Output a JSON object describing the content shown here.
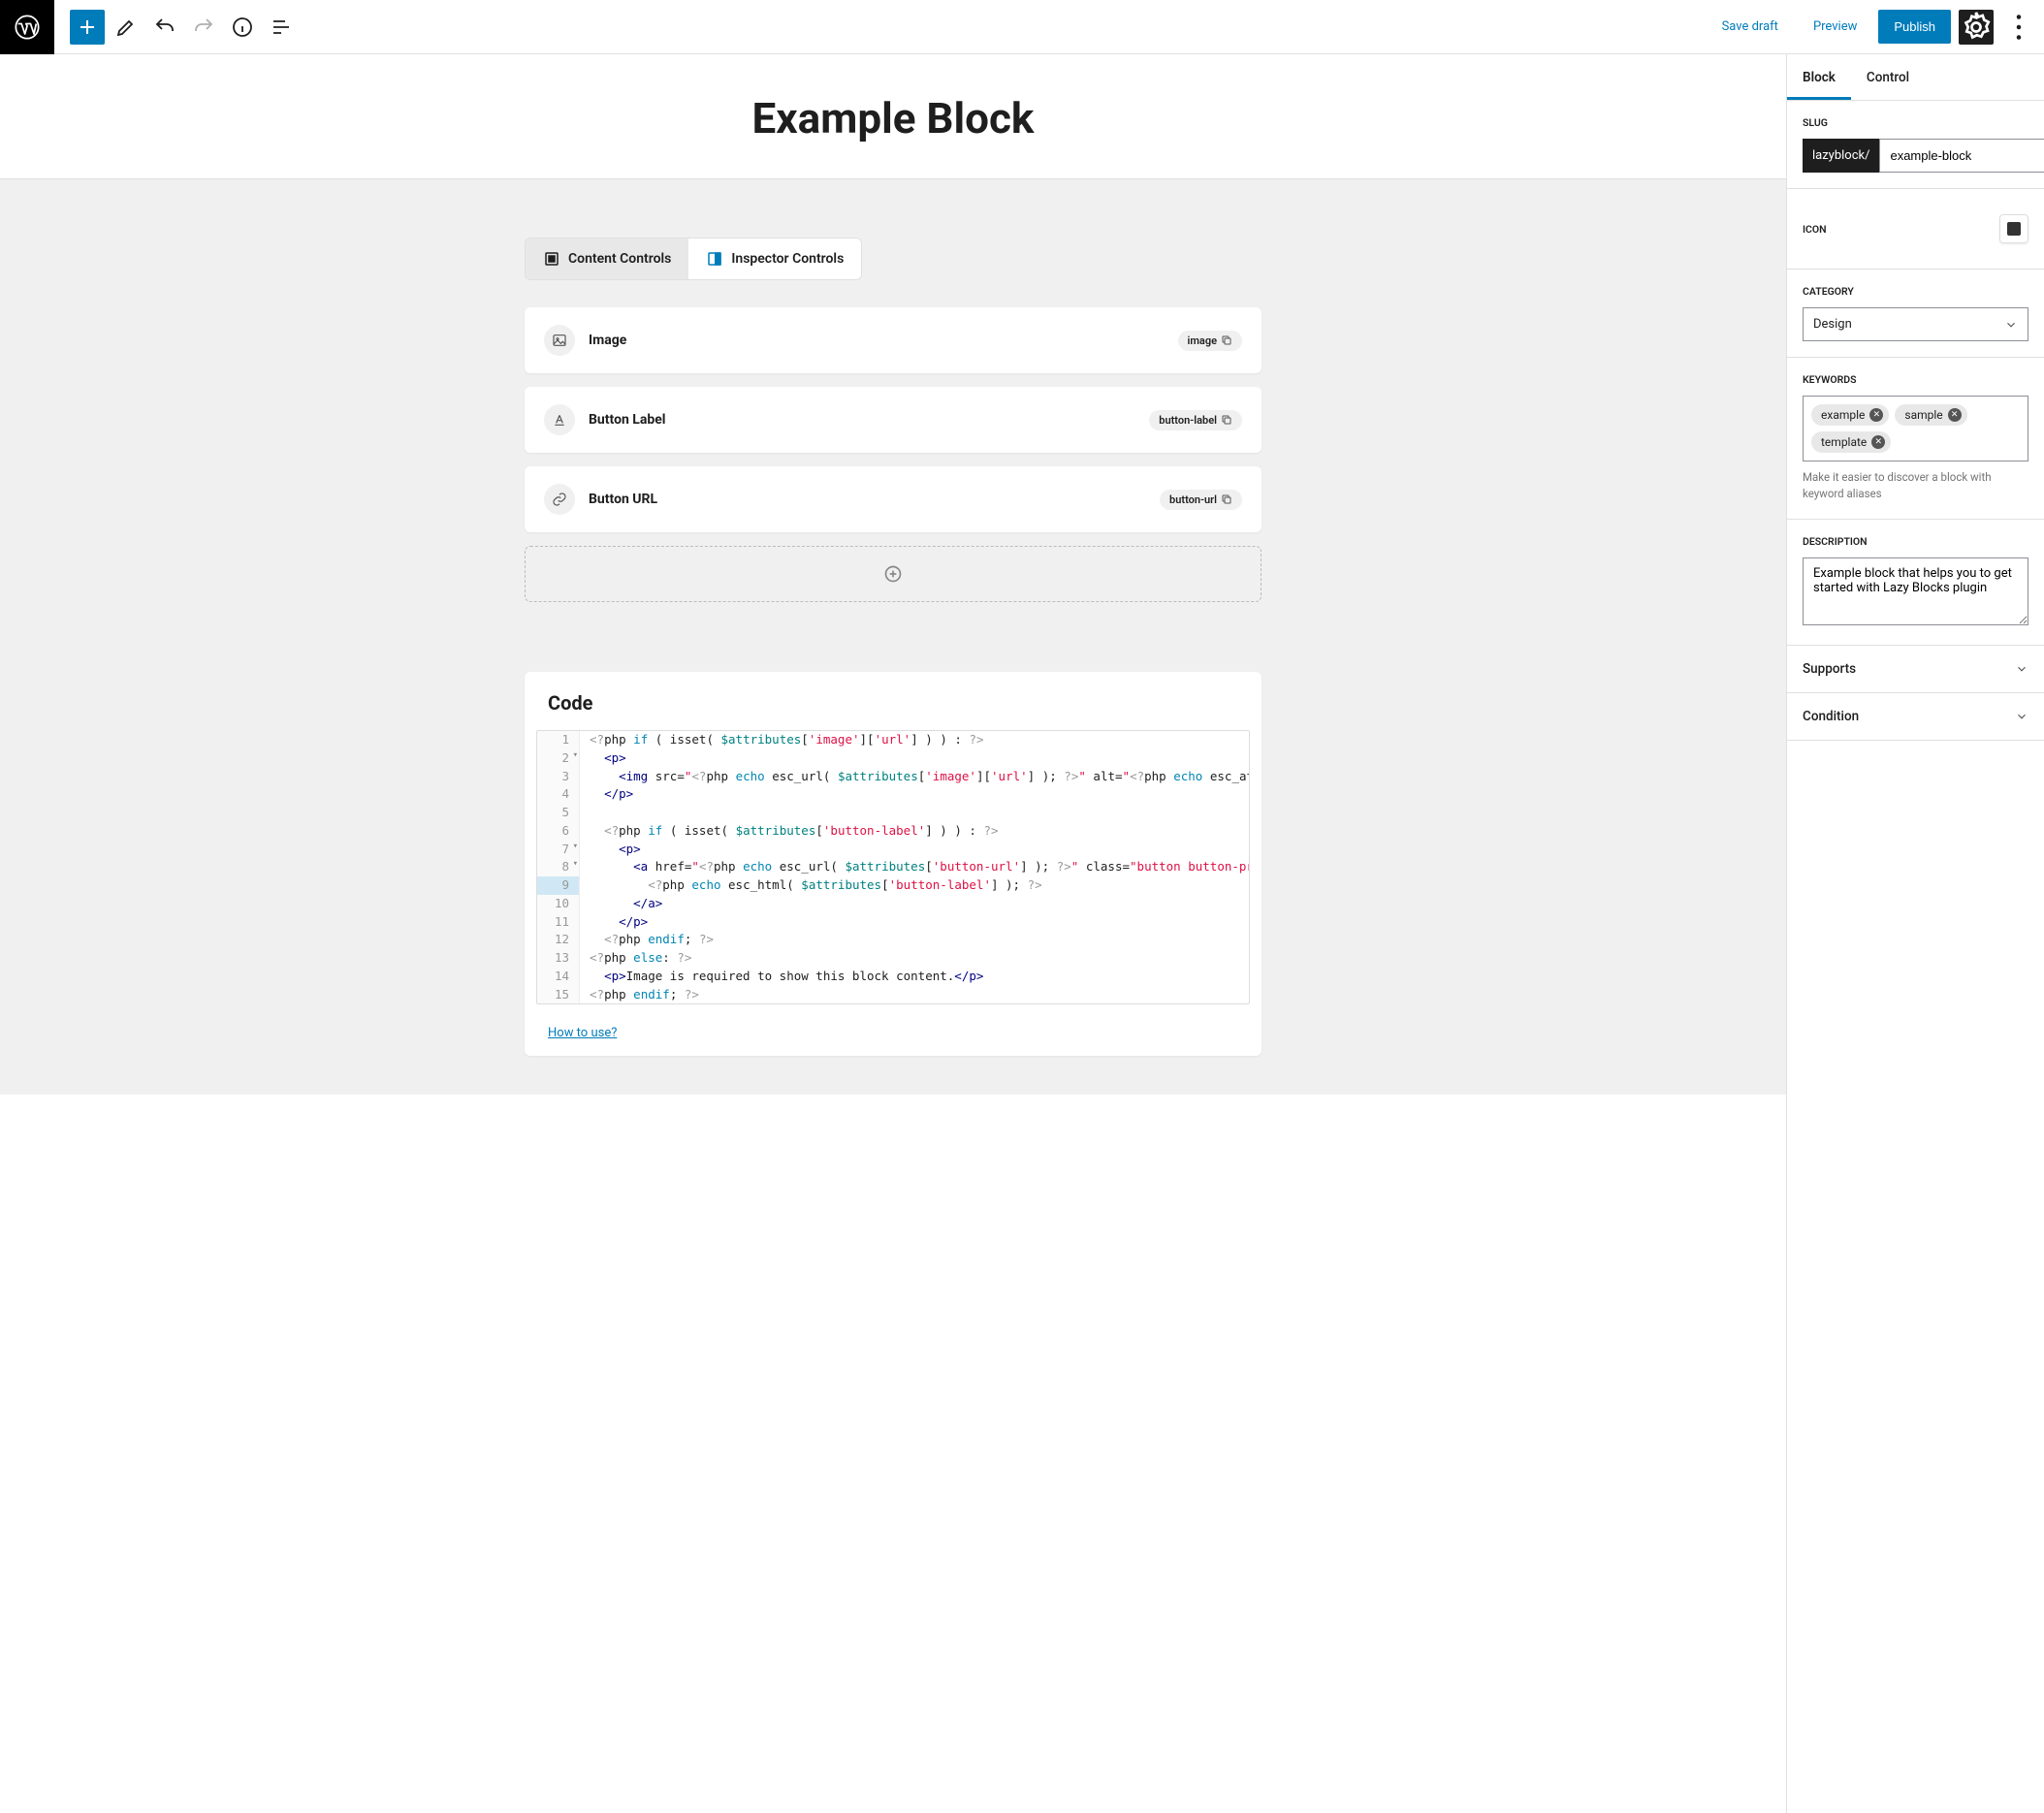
{
  "topbar": {
    "save_draft": "Save draft",
    "preview": "Preview",
    "publish": "Publish"
  },
  "page_title": "Example Block",
  "tabs": {
    "content": "Content Controls",
    "inspector": "Inspector Controls"
  },
  "controls": [
    {
      "label": "Image",
      "slug": "image",
      "icon": "image"
    },
    {
      "label": "Button Label",
      "slug": "button-label",
      "icon": "text"
    },
    {
      "label": "Button URL",
      "slug": "button-url",
      "icon": "link"
    }
  ],
  "code": {
    "heading": "Code",
    "how_link": "How to use?"
  },
  "sidebar": {
    "tabs": {
      "block": "Block",
      "control": "Control"
    },
    "slug": {
      "label": "SLUG",
      "prefix": "lazyblock/",
      "value": "example-block"
    },
    "icon": {
      "label": "ICON"
    },
    "category": {
      "label": "CATEGORY",
      "value": "Design"
    },
    "keywords": {
      "label": "KEYWORDS",
      "items": [
        "example",
        "sample",
        "template"
      ],
      "help": "Make it easier to discover a block with keyword aliases"
    },
    "description": {
      "label": "DESCRIPTION",
      "value": "Example block that helps you to get started with Lazy Blocks plugin"
    },
    "supports": "Supports",
    "condition": "Condition"
  }
}
